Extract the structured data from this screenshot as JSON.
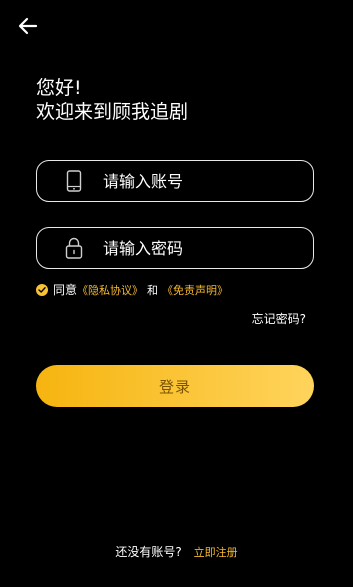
{
  "header": {
    "back_icon": "arrow-left-icon"
  },
  "greeting": {
    "line1": "您好!",
    "line2": "欢迎来到顾我追剧"
  },
  "account_field": {
    "placeholder": "请输入账号",
    "value": "",
    "icon": "phone-icon"
  },
  "password_field": {
    "placeholder": "请输入密码",
    "value": "",
    "icon": "lock-icon"
  },
  "agreement": {
    "checked": true,
    "prefix": "同意",
    "privacy_link": "《隐私协议》",
    "conjunction": "和",
    "disclaimer_link": "《免责声明》"
  },
  "forgot_password": "忘记密码?",
  "login_button": "登录",
  "register": {
    "question": "还没有账号?",
    "link": "立即注册"
  },
  "colors": {
    "background": "#000000",
    "accent": "#f5b92e",
    "button_start": "#f6b40f",
    "button_end": "#ffd45c"
  }
}
